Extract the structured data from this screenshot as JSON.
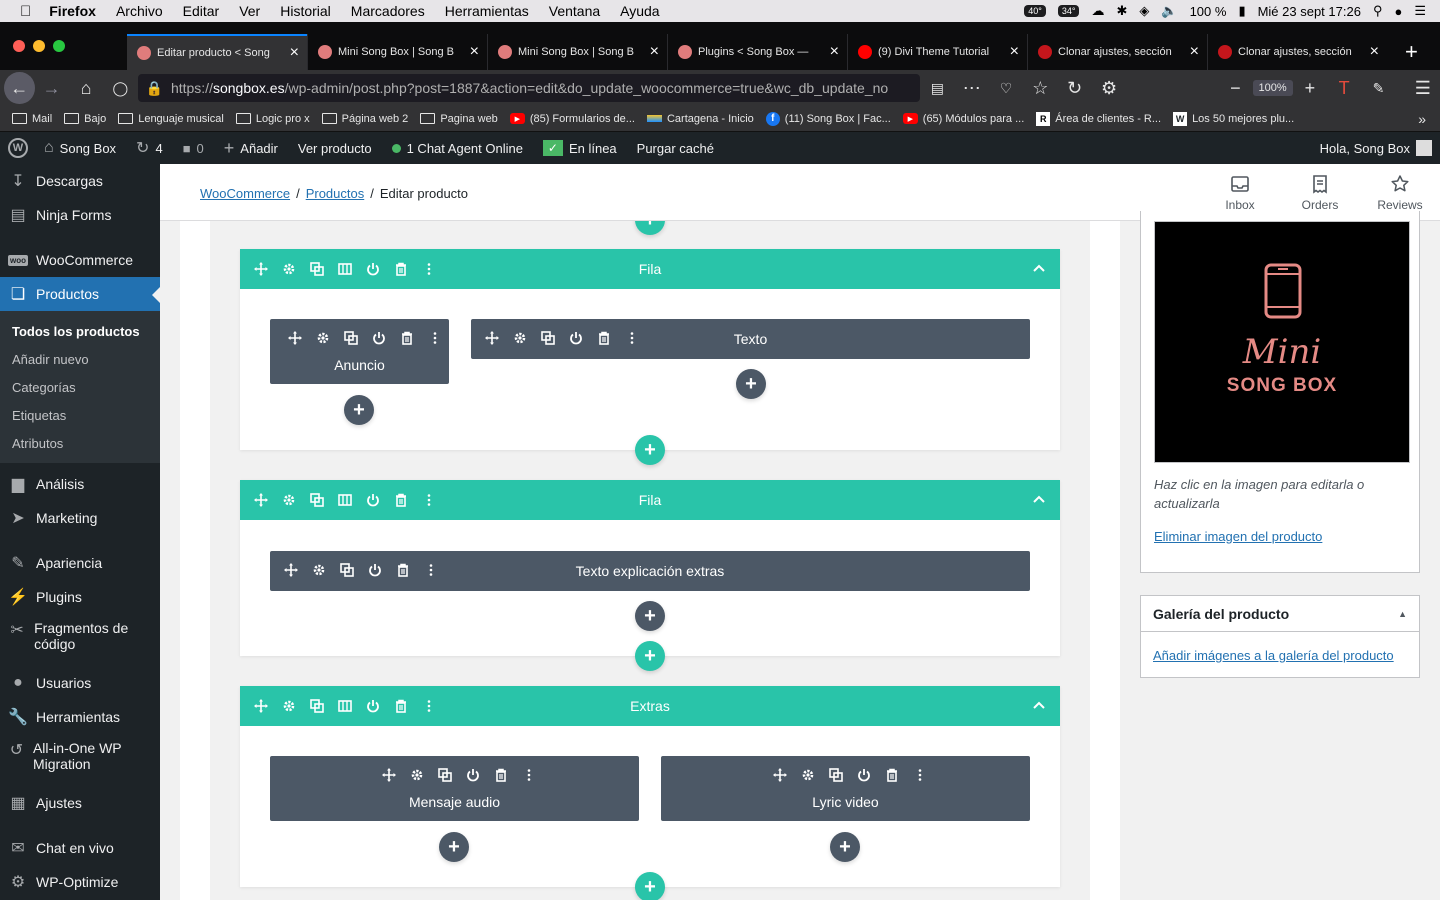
{
  "macos": {
    "menu": [
      "Archivo",
      "Editar",
      "Ver",
      "Historial",
      "Marcadores",
      "Herramientas",
      "Ventana",
      "Ayuda"
    ],
    "app": "Firefox",
    "temps": [
      "40°",
      "34°"
    ],
    "battery": "100 %",
    "datetime": "Mié 23 sept  17:26"
  },
  "tabs": [
    {
      "title": "Editar producto < Song",
      "fav": "#e07c7c"
    },
    {
      "title": "Mini Song Box | Song B",
      "fav": "#e07c7c"
    },
    {
      "title": "Mini Song Box | Song B",
      "fav": "#e07c7c"
    },
    {
      "title": "Plugins < Song Box —",
      "fav": "#e07c7c"
    },
    {
      "title": "(9) Divi Theme Tutorial",
      "fav": "#ff0000"
    },
    {
      "title": "Clonar ajustes, sección",
      "fav": "#c4161c"
    },
    {
      "title": "Clonar ajustes, sección",
      "fav": "#c4161c"
    }
  ],
  "url": {
    "prefix": "https://",
    "host": "songbox.es",
    "path": "/wp-admin/post.php?post=1887&action=edit&do_update_woocommerce=true&wc_db_update_no"
  },
  "zoom": "100%",
  "bookmarks": [
    {
      "label": "Mail",
      "icon": "folder"
    },
    {
      "label": "Bajo",
      "icon": "folder"
    },
    {
      "label": "Lenguaje musical",
      "icon": "folder"
    },
    {
      "label": "Logic pro x",
      "icon": "folder"
    },
    {
      "label": "Página web 2",
      "icon": "folder"
    },
    {
      "label": "Pagina web",
      "icon": "folder"
    },
    {
      "label": "(85) Formularios de...",
      "icon": "youtube"
    },
    {
      "label": "Cartagena - Inicio",
      "icon": "flag"
    },
    {
      "label": "(11) Song Box | Fac...",
      "icon": "facebook"
    },
    {
      "label": "(65) Módulos para ...",
      "icon": "youtube"
    },
    {
      "label": "Área de clientes - R...",
      "icon": "r"
    },
    {
      "label": "Los 50 mejores plu...",
      "icon": "w"
    }
  ],
  "adminbar": {
    "site": "Song Box",
    "updates": "4",
    "comments": "0",
    "add": "Añadir",
    "view": "Ver producto",
    "chat": "1 Chat Agent Online",
    "online": "En línea",
    "purge": "Purgar caché",
    "greeting": "Hola, Song Box"
  },
  "sidebar": {
    "top": [
      {
        "label": "Descargas",
        "icon": "download"
      },
      {
        "label": "Ninja Forms",
        "icon": "forms"
      },
      {
        "label": "WooCommerce",
        "icon": "woo"
      },
      {
        "label": "Productos",
        "icon": "box"
      }
    ],
    "sub": [
      "Todos los productos",
      "Añadir nuevo",
      "Categorías",
      "Etiquetas",
      "Atributos"
    ],
    "bottom": [
      {
        "label": "Análisis",
        "icon": "chart"
      },
      {
        "label": "Marketing",
        "icon": "megaphone"
      },
      {
        "label": "Apariencia",
        "icon": "brush"
      },
      {
        "label": "Plugins",
        "icon": "plug"
      },
      {
        "label": "Fragmentos de código",
        "icon": "scissors"
      },
      {
        "label": "Usuarios",
        "icon": "user"
      },
      {
        "label": "Herramientas",
        "icon": "wrench"
      },
      {
        "label": "All-in-One WP Migration",
        "icon": "migrate"
      },
      {
        "label": "Ajustes",
        "icon": "settings"
      },
      {
        "label": "Chat en vivo",
        "icon": "chat"
      },
      {
        "label": "WP-Optimize",
        "icon": "optimize"
      }
    ]
  },
  "breadcrumb": {
    "woo": "WooCommerce",
    "products": "Productos",
    "current": "Editar producto"
  },
  "header_icons": {
    "inbox": "Inbox",
    "orders": "Orders",
    "reviews": "Reviews"
  },
  "builder": {
    "row1": {
      "title": "Fila",
      "mod1": "Anuncio",
      "mod2": "Texto"
    },
    "row2": {
      "title": "Fila",
      "mod1": "Texto explicación extras"
    },
    "row3": {
      "title": "Extras",
      "mod1": "Mensaje audio",
      "mod2": "Lyric video"
    }
  },
  "product_image": {
    "logo_script": "Mini",
    "logo_text": "SONG BOX",
    "hint": "Haz clic en la imagen para editarla o actualizarla",
    "remove": "Eliminar imagen del producto"
  },
  "gallery": {
    "title": "Galería del producto",
    "add": "Añadir imágenes a la galería del producto"
  },
  "colors": {
    "teal": "#29c4a9",
    "module": "#4c5866",
    "wp_blue": "#2271b1",
    "admin_dark": "#1d2327"
  }
}
